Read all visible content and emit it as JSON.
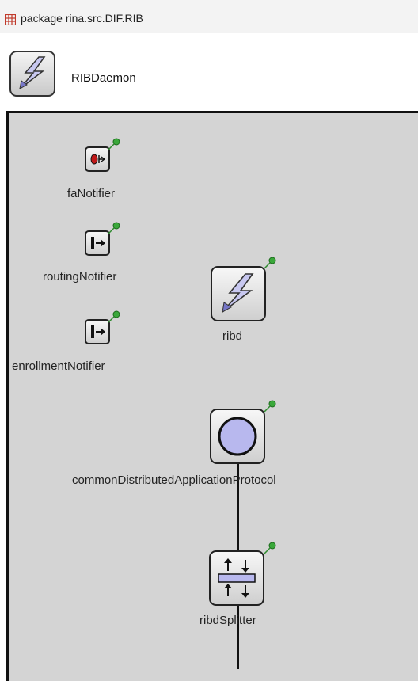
{
  "package": {
    "label": "package rina.src.DIF.RIB",
    "icon": "package-grid-icon"
  },
  "module": {
    "title": "RIBDaemon",
    "icon": "lightning-module-icon"
  },
  "submodules": [
    {
      "id": "faNotifier",
      "label": "faNotifier",
      "icon": "notifier-red-icon"
    },
    {
      "id": "routingNotifier",
      "label": "routingNotifier",
      "icon": "notifier-arrow-icon"
    },
    {
      "id": "enrollmentNotifier",
      "label": "enrollmentNotifier",
      "icon": "notifier-arrow-icon"
    },
    {
      "id": "ribd",
      "label": "ribd",
      "icon": "lightning-module-icon"
    },
    {
      "id": "cdap",
      "label": "commonDistributedApplicationProtocol",
      "icon": "circle-protocol-icon"
    },
    {
      "id": "ribdSplitter",
      "label": "ribdSplitter",
      "icon": "splitter-icon"
    }
  ],
  "colors": {
    "canvas_bg": "#d4d4d4",
    "package_bar_bg": "#f3f3f3",
    "pin_green": "#3aa83a",
    "circle_fill": "#b8b8ee"
  }
}
